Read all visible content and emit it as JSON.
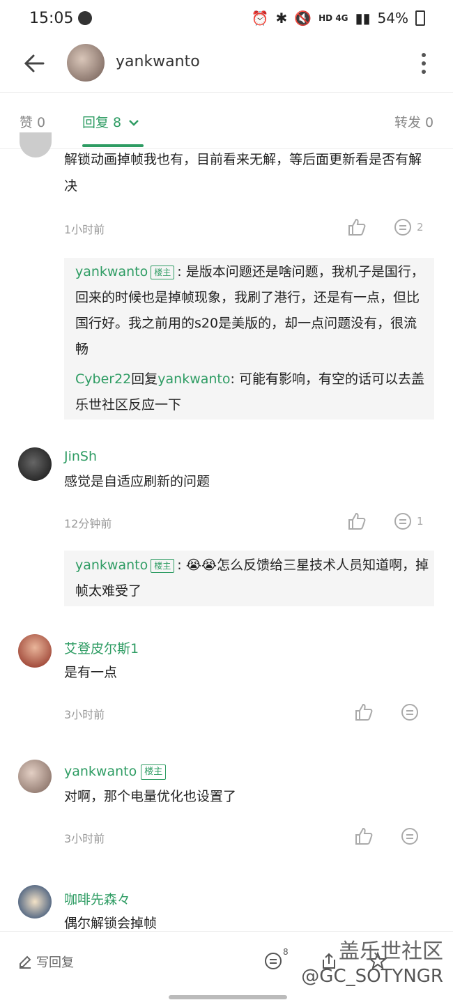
{
  "status_bar": {
    "time": "15:05",
    "indicators": "HD  4G",
    "battery": "54%"
  },
  "header": {
    "title": "yankwanto"
  },
  "tabs": {
    "likes": "赞 0",
    "replies": "回复 8",
    "forwards": "转发 0"
  },
  "comments": [
    {
      "text": "解锁动画掉帧我也有，目前看来无解，等后面更新看是否有解决",
      "time": "1小时前",
      "reply_count": "2",
      "replies": [
        {
          "user": "yankwanto",
          "badge": "楼主",
          "text": "是版本问题还是啥问题，我机子是国行，回来的时候也是掉帧现象，我刷了港行，还是有一点，但比国行好。我之前用的s20是美版的，却一点问题没有，很流畅"
        },
        {
          "user": "Cyber22",
          "reply_word": "回复",
          "to": "yankwanto",
          "text": "可能有影响，有空的话可以去盖乐世社区反应一下"
        }
      ]
    },
    {
      "user": "JinSh",
      "text": "感觉是自适应刷新的问题",
      "time": "12分钟前",
      "reply_count": "1",
      "replies": [
        {
          "user": "yankwanto",
          "badge": "楼主",
          "emoji": "😭😭",
          "text": "怎么反馈给三星技术人员知道啊，掉帧太难受了"
        }
      ]
    },
    {
      "user": "艾登皮尔斯1",
      "text": "是有一点",
      "time": "3小时前"
    },
    {
      "user": "yankwanto",
      "badge": "楼主",
      "text": "对啊，那个电量优化也设置了",
      "time": "3小时前"
    },
    {
      "user": "咖啡先森々",
      "text": "偶尔解锁会掉帧"
    }
  ],
  "bottom_bar": {
    "write_reply": "写回复",
    "reply_count": "8"
  },
  "watermark": {
    "line1": "盖乐世社区",
    "line2": "@GC_SOTYNGR"
  },
  "colors": {
    "accent": "#2e9c63",
    "reply_bg": "#f5f5f5"
  }
}
